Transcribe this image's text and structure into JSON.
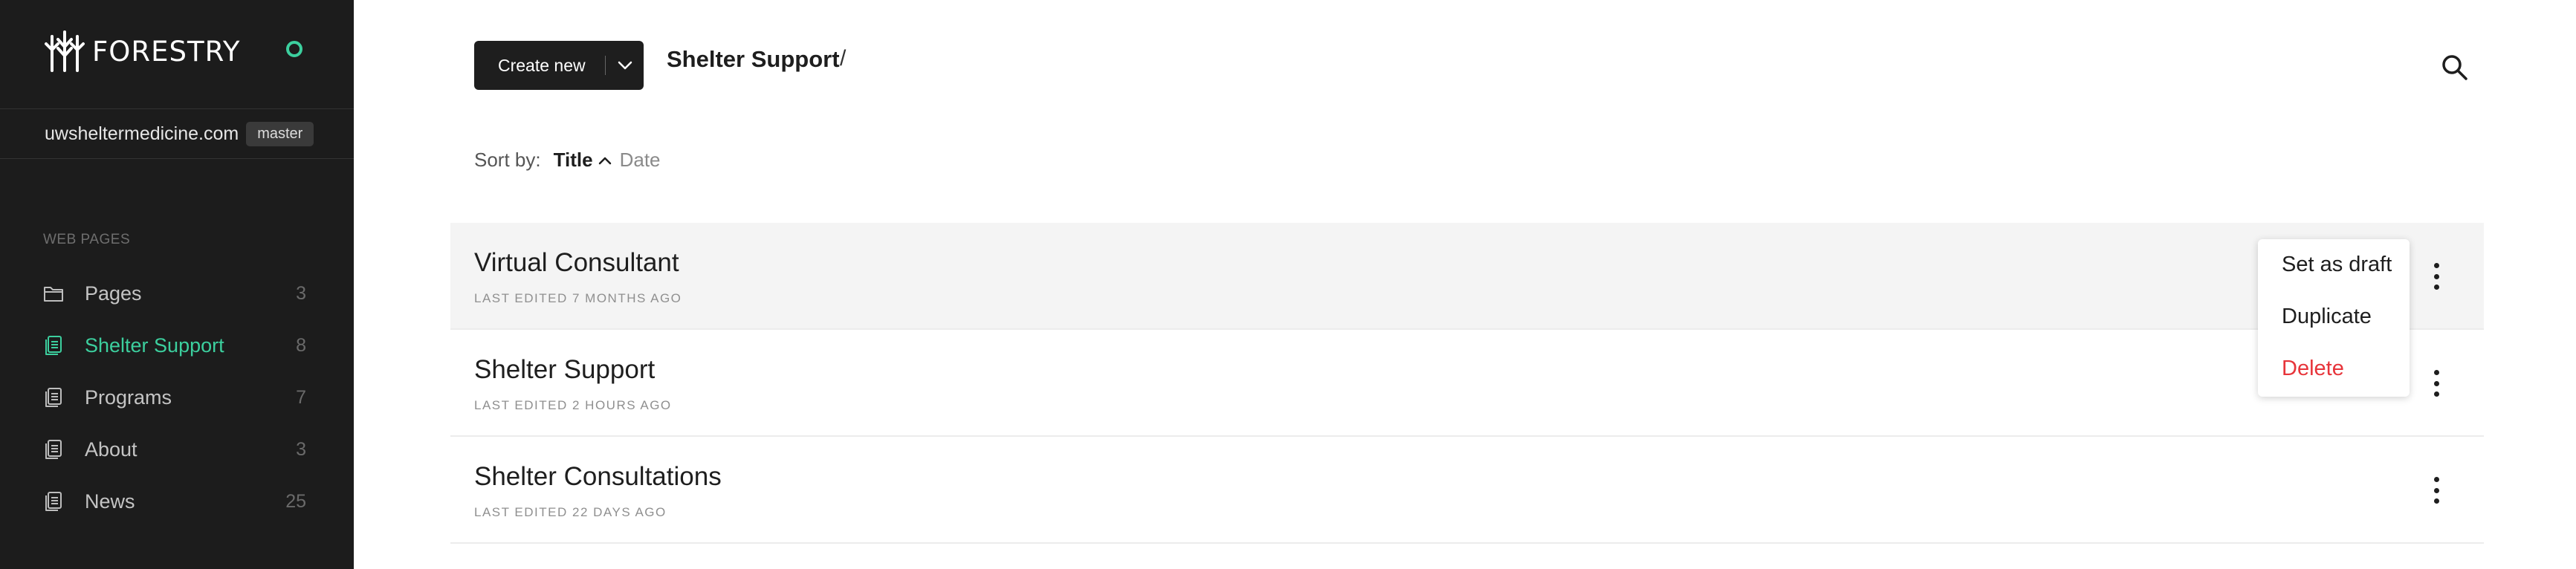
{
  "sidebar": {
    "brand": "FORESTRY",
    "site_name": "uwsheltermedicine.com",
    "branch": "master",
    "section_label": "WEB PAGES",
    "items": [
      {
        "label": "Pages",
        "count": "3",
        "icon": "folder-icon"
      },
      {
        "label": "Shelter Support",
        "count": "8",
        "icon": "document-icon",
        "active": true
      },
      {
        "label": "Programs",
        "count": "7",
        "icon": "document-icon"
      },
      {
        "label": "About",
        "count": "3",
        "icon": "document-icon"
      },
      {
        "label": "News",
        "count": "25",
        "icon": "document-icon"
      }
    ]
  },
  "header": {
    "create_label": "Create new",
    "breadcrumb": "Shelter Support",
    "breadcrumb_sep": "/"
  },
  "sort": {
    "label": "Sort by:",
    "active": "Title",
    "other": "Date"
  },
  "documents": [
    {
      "title": "Virtual Consultant",
      "meta": "LAST EDITED 7 MONTHS AGO"
    },
    {
      "title": "Shelter Support",
      "meta": "LAST EDITED 2 HOURS AGO"
    },
    {
      "title": "Shelter Consultations",
      "meta": "LAST EDITED 22 DAYS AGO"
    }
  ],
  "menu": {
    "set_draft": "Set as draft",
    "duplicate": "Duplicate",
    "delete": "Delete"
  },
  "colors": {
    "accent": "#3ccf9e",
    "danger": "#e7343a",
    "sidebar_bg": "#1c1c1c"
  }
}
